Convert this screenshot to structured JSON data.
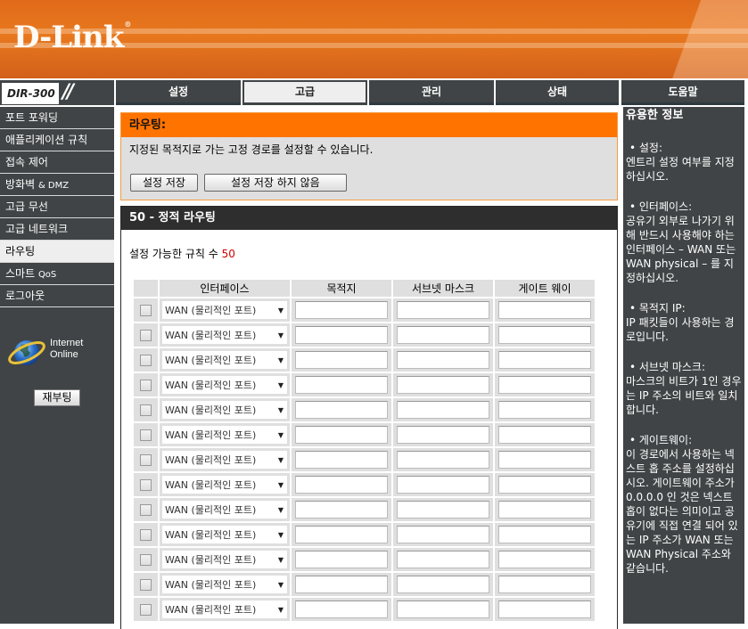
{
  "brand": {
    "logo": "D-Link",
    "registered": "®",
    "model": "DIR-300"
  },
  "topnav": {
    "tabs": [
      {
        "label": "설정",
        "active": false
      },
      {
        "label": "고급",
        "active": true
      },
      {
        "label": "관리",
        "active": false
      },
      {
        "label": "상태",
        "active": false
      },
      {
        "label": "도움말",
        "active": false
      }
    ]
  },
  "sidebar": {
    "items": [
      {
        "label": "포트 포워딩",
        "active": false
      },
      {
        "label": "애플리케이션 규칙",
        "active": false
      },
      {
        "label": "접속 제어",
        "active": false
      },
      {
        "label": "방화벽 ",
        "latin": "& DMZ",
        "active": false
      },
      {
        "label": "고급 무선",
        "active": false
      },
      {
        "label": "고급 네트워크",
        "active": false
      },
      {
        "label": "라우팅",
        "active": true
      },
      {
        "label": "스마트 ",
        "latin": "QoS",
        "active": false
      },
      {
        "label": "로그아웃",
        "active": false
      }
    ],
    "status_line1": "Internet",
    "status_line2": "Online",
    "status_icon": "globe-icon",
    "reboot_label": "재부팅"
  },
  "intro": {
    "title": "라우팅:",
    "description": "지정된 목적지로 가는 고정 경로를 설정할 수 있습니다.",
    "save_label": "설정 저장",
    "dont_save_label": "설정 저장 하지 않음"
  },
  "routes": {
    "title": "50 - 정적 라우팅",
    "count_label": "설정 가능한 규칙 수 ",
    "count_value": "50",
    "columns": [
      "",
      "인터페이스",
      "목적지",
      "서브넷 마스크",
      "게이트 웨이"
    ],
    "rows": [
      {
        "enabled": false,
        "interface": "WAN (물리적인 포트)",
        "destination": "",
        "subnet_mask": "",
        "gateway": ""
      },
      {
        "enabled": false,
        "interface": "WAN (물리적인 포트)",
        "destination": "",
        "subnet_mask": "",
        "gateway": ""
      },
      {
        "enabled": false,
        "interface": "WAN (물리적인 포트)",
        "destination": "",
        "subnet_mask": "",
        "gateway": ""
      },
      {
        "enabled": false,
        "interface": "WAN (물리적인 포트)",
        "destination": "",
        "subnet_mask": "",
        "gateway": ""
      },
      {
        "enabled": false,
        "interface": "WAN (물리적인 포트)",
        "destination": "",
        "subnet_mask": "",
        "gateway": ""
      },
      {
        "enabled": false,
        "interface": "WAN (물리적인 포트)",
        "destination": "",
        "subnet_mask": "",
        "gateway": ""
      },
      {
        "enabled": false,
        "interface": "WAN (물리적인 포트)",
        "destination": "",
        "subnet_mask": "",
        "gateway": ""
      },
      {
        "enabled": false,
        "interface": "WAN (물리적인 포트)",
        "destination": "",
        "subnet_mask": "",
        "gateway": ""
      },
      {
        "enabled": false,
        "interface": "WAN (물리적인 포트)",
        "destination": "",
        "subnet_mask": "",
        "gateway": ""
      },
      {
        "enabled": false,
        "interface": "WAN (물리적인 포트)",
        "destination": "",
        "subnet_mask": "",
        "gateway": ""
      },
      {
        "enabled": false,
        "interface": "WAN (물리적인 포트)",
        "destination": "",
        "subnet_mask": "",
        "gateway": ""
      },
      {
        "enabled": false,
        "interface": "WAN (물리적인 포트)",
        "destination": "",
        "subnet_mask": "",
        "gateway": ""
      },
      {
        "enabled": false,
        "interface": "WAN (물리적인 포트)",
        "destination": "",
        "subnet_mask": "",
        "gateway": ""
      }
    ]
  },
  "help": {
    "title": "유용한 정보",
    "entries": [
      {
        "heading": "• 설정:",
        "body": "엔트리 설정 여부를 지정하십시오."
      },
      {
        "heading": "• 인터페이스:",
        "body": "공유기 외부로 나가기 위해 반드시 사용해야 하는 인터페이스 – WAN 또는 WAN physical – 를 지정하십시오."
      },
      {
        "heading": "• 목적지 IP:",
        "body": "IP 패킷들이 사용하는 경로입니다."
      },
      {
        "heading": "• 서브넷 마스크:",
        "body": "마스크의 비트가 1인 경우는 IP 주소의 비트와 일치합니다."
      },
      {
        "heading": "• 게이트웨이:",
        "body": "이 경로에서 사용하는 넥스트 홉 주소를 설정하십시오. 게이트웨이 주소가 0.0.0.0 인 것은 넥스트 홉이 없다는 의미이고 공유기에 직접 연결 되어 있는 IP 주소가 WAN 또는 WAN Physical 주소와 같습니다."
      }
    ]
  },
  "colors": {
    "accent_orange": "#ff7300",
    "nav_dark": "#404446",
    "count_red": "#d00000"
  }
}
